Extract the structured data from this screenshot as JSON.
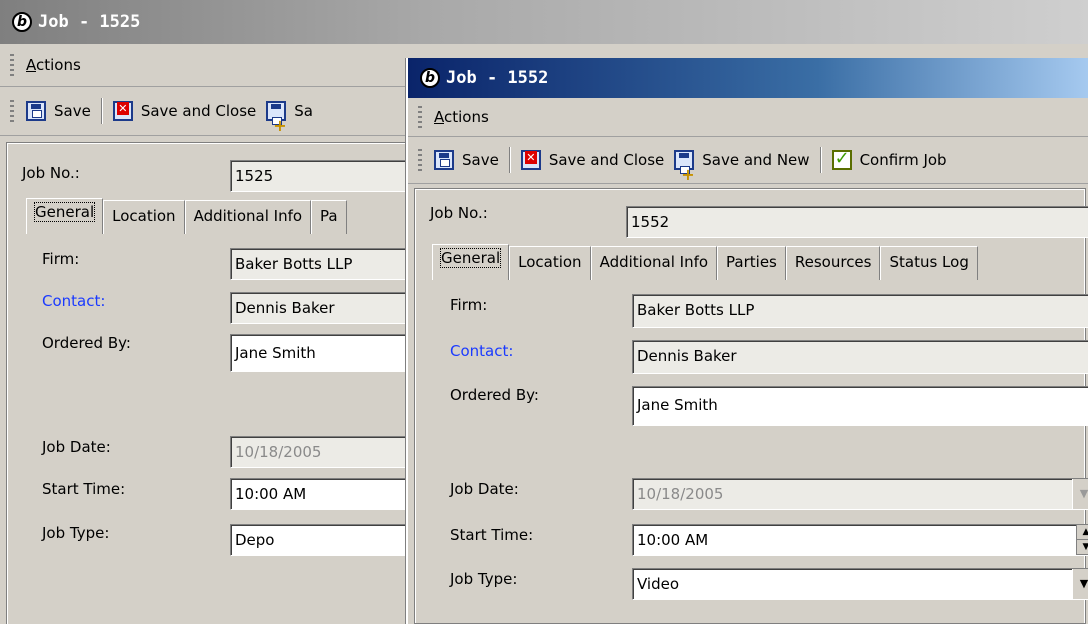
{
  "window_back": {
    "title": "Job - 1525",
    "menu": {
      "actions_label": "Actions",
      "actions_mnemonic": "A",
      "actions_rest": "ctions"
    },
    "toolbar": {
      "save_label": "Save",
      "save_close_label": "Save and Close",
      "save_new_partial": "Sa"
    },
    "job_no_label": "Job No.:",
    "job_no_value": "1525",
    "tabs": [
      "General",
      "Location",
      "Additional Info",
      "Pa"
    ],
    "fields": {
      "firm_label": "Firm:",
      "firm_value": "Baker Botts LLP",
      "contact_label": "Contact:",
      "contact_value": "Dennis Baker",
      "ordered_by_label": "Ordered By:",
      "ordered_by_value": "Jane Smith",
      "job_date_label": "Job Date:",
      "job_date_value": "10/18/2005",
      "start_time_label": "Start Time:",
      "start_time_value": "10:00 AM",
      "job_type_label": "Job Type:",
      "job_type_value": "Depo"
    }
  },
  "window_front": {
    "title": "Job - 1552",
    "menu": {
      "actions_mnemonic": "A",
      "actions_rest": "ctions"
    },
    "toolbar": {
      "save_label": "Save",
      "save_close_label": "Save and Close",
      "save_new_label": "Save and New",
      "confirm_label": "Confirm Job"
    },
    "job_no_label": "Job No.:",
    "job_no_value": "1552",
    "tabs": [
      "General",
      "Location",
      "Additional Info",
      "Parties",
      "Resources",
      "Status Log"
    ],
    "fields": {
      "firm_label": "Firm:",
      "firm_value": "Baker Botts LLP",
      "contact_label": "Contact:",
      "contact_value": "Dennis Baker",
      "ordered_by_label": "Ordered By:",
      "ordered_by_value": "Jane Smith",
      "job_date_label": "Job Date:",
      "job_date_value": "10/18/2005",
      "start_time_label": "Start Time:",
      "start_time_value": "10:00 AM",
      "job_type_label": "Job Type:",
      "job_type_value": "Video"
    }
  },
  "colors": {
    "active_title": "#0a246a",
    "inactive_title": "#7f7f7f",
    "link_label": "#1a3aff",
    "face": "#d4d0c8"
  },
  "icons": [
    "app-logo-icon",
    "save-icon",
    "save-close-icon",
    "save-new-icon",
    "confirm-icon",
    "spin-up-icon",
    "spin-down-icon",
    "dropdown-arrow-icon"
  ]
}
